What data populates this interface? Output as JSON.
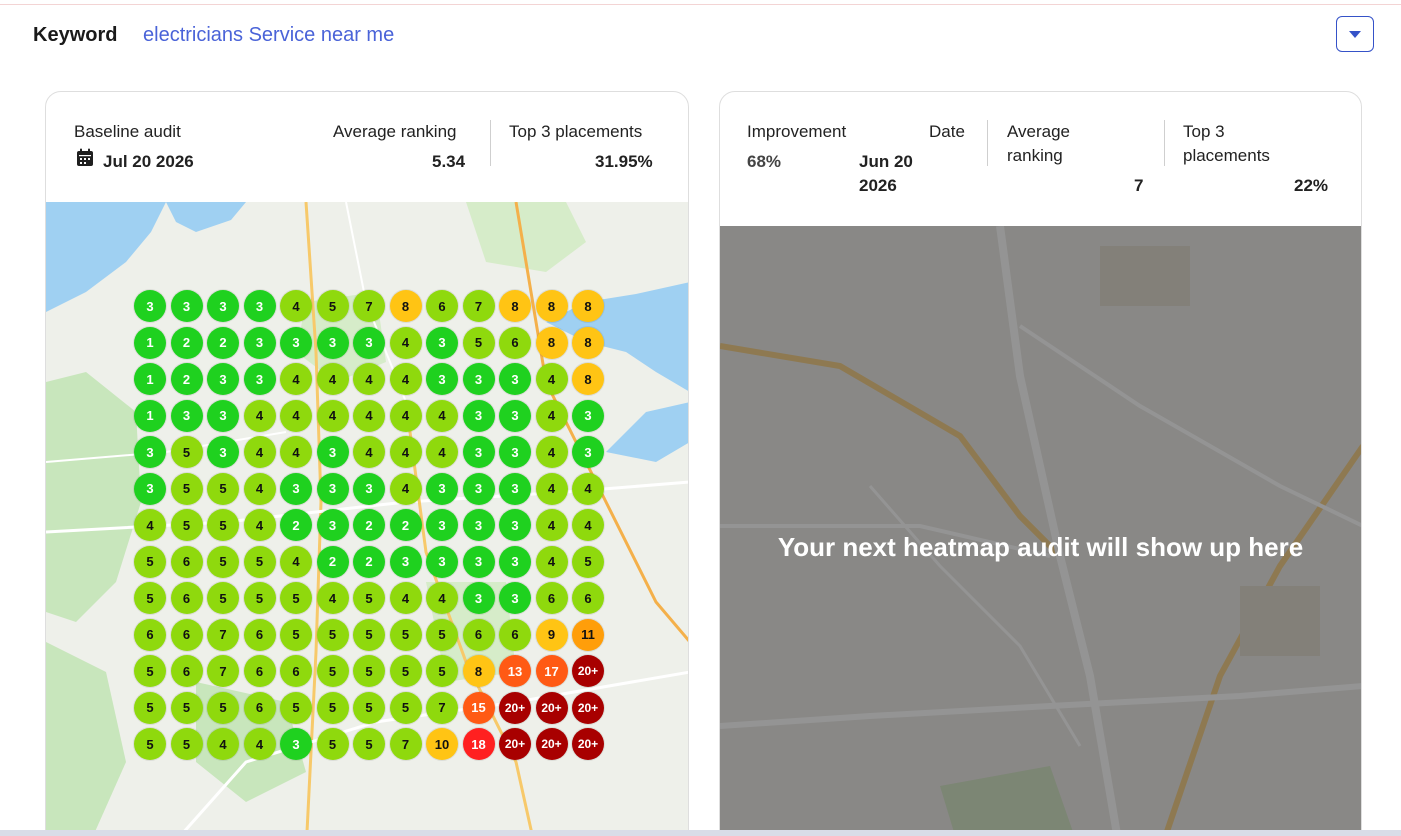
{
  "keyword": {
    "label": "Keyword",
    "value": "electricians Service near me"
  },
  "baseline": {
    "title": "Baseline audit",
    "date": "Jul 20 2026",
    "avg_label": "Average ranking",
    "avg_value": "5.34",
    "top3_label": "Top 3 placements",
    "top3_value": "31.95%"
  },
  "next": {
    "improvement_label": "Improvement",
    "improvement_value": "68%",
    "date_label": "Date",
    "date_value_line1": "Jun 20",
    "date_value_line2": "2026",
    "avg_label_line1": "Average",
    "avg_label_line2": "ranking",
    "avg_value": "7",
    "top3_label_line1": "Top 3",
    "top3_label_line2": "placements",
    "top3_value": "22%",
    "placeholder_text": "Your next heatmap audit will show up here"
  },
  "colors": {
    "top3": "#1fd11f",
    "mid": "#8fd90d",
    "high": "#ffc414",
    "orange": "#ff9e0a",
    "red_orange": "#ff5a14",
    "red": "#ff2020",
    "dark_red": "#a80000",
    "accent": "#4a63d8"
  },
  "icons": {
    "calendar": "calendar-icon",
    "dropdown": "chevron-down-icon"
  },
  "heatmap": [
    [
      "3",
      "3",
      "3",
      "3",
      "4",
      "5",
      "7",
      "8",
      "6",
      "7",
      "8",
      "8",
      "8"
    ],
    [
      "1",
      "2",
      "2",
      "3",
      "3",
      "3",
      "3",
      "4",
      "3",
      "5",
      "6",
      "8",
      "8"
    ],
    [
      "1",
      "2",
      "3",
      "3",
      "4",
      "4",
      "4",
      "4",
      "3",
      "3",
      "3",
      "4",
      "8"
    ],
    [
      "1",
      "3",
      "3",
      "4",
      "4",
      "4",
      "4",
      "4",
      "4",
      "3",
      "3",
      "4",
      "3"
    ],
    [
      "3",
      "5",
      "3",
      "4",
      "4",
      "3",
      "4",
      "4",
      "4",
      "3",
      "3",
      "4",
      "3"
    ],
    [
      "3",
      "5",
      "5",
      "4",
      "3",
      "3",
      "3",
      "4",
      "3",
      "3",
      "3",
      "4",
      "4"
    ],
    [
      "4",
      "5",
      "5",
      "4",
      "2",
      "3",
      "2",
      "2",
      "3",
      "3",
      "3",
      "4",
      "4"
    ],
    [
      "5",
      "6",
      "5",
      "5",
      "4",
      "2",
      "2",
      "3",
      "3",
      "3",
      "3",
      "4",
      "5"
    ],
    [
      "5",
      "6",
      "5",
      "5",
      "5",
      "4",
      "5",
      "4",
      "4",
      "3",
      "3",
      "6",
      "6"
    ],
    [
      "6",
      "6",
      "7",
      "6",
      "5",
      "5",
      "5",
      "5",
      "5",
      "6",
      "6",
      "9",
      "11"
    ],
    [
      "5",
      "6",
      "7",
      "6",
      "6",
      "5",
      "5",
      "5",
      "5",
      "8",
      "13",
      "17",
      "20+"
    ],
    [
      "5",
      "5",
      "5",
      "6",
      "5",
      "5",
      "5",
      "5",
      "7",
      "15",
      "20+",
      "20+",
      "20+"
    ],
    [
      "5",
      "5",
      "4",
      "4",
      "3",
      "5",
      "5",
      "7",
      "10",
      "18",
      "20+",
      "20+",
      "20+"
    ]
  ]
}
